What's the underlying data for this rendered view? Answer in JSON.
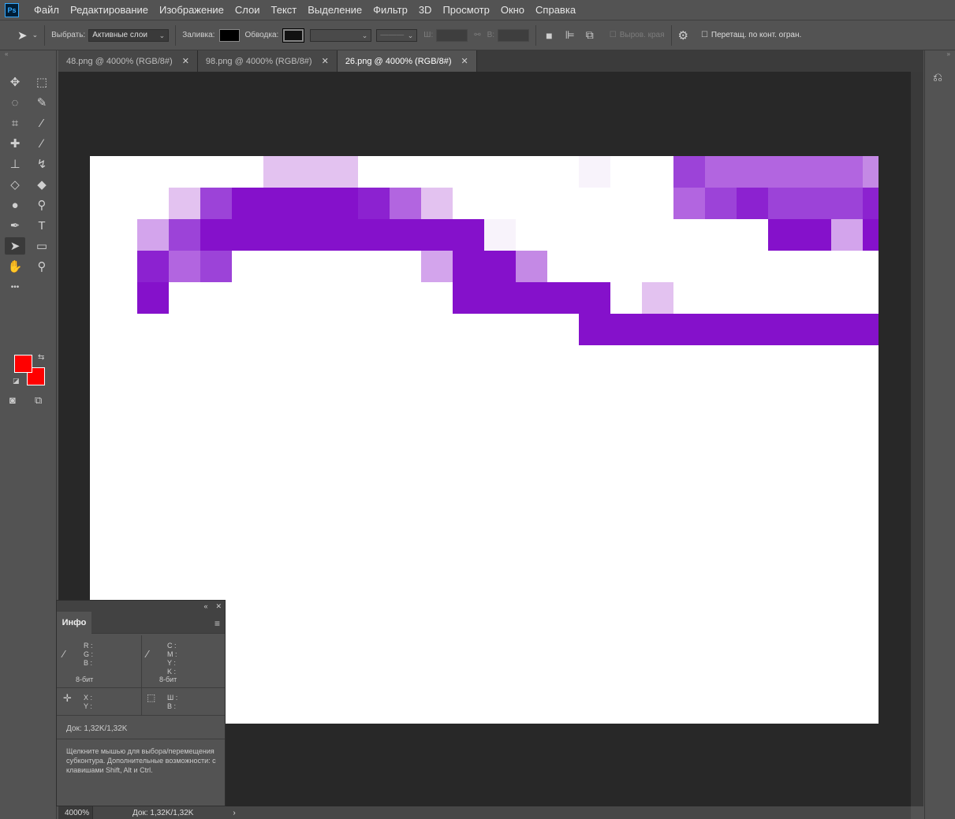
{
  "app": {
    "logo": "Ps"
  },
  "menu": [
    "Файл",
    "Редактирование",
    "Изображение",
    "Слои",
    "Текст",
    "Выделение",
    "Фильтр",
    "3D",
    "Просмотр",
    "Окно",
    "Справка"
  ],
  "options": {
    "select_label": "Выбрать:",
    "select_value": "Активные слои",
    "fill_label": "Заливка:",
    "stroke_label": "Обводка:",
    "w_label": "Ш:",
    "h_label": "В:",
    "align_edges": "Выров. края",
    "constrain": "Перетащ. по конт. огран."
  },
  "tabs": [
    {
      "label": "48.png @ 4000% (RGB/8#)",
      "active": false
    },
    {
      "label": "98.png @ 4000% (RGB/8#)",
      "active": false
    },
    {
      "label": "26.png @ 4000% (RGB/8#)",
      "active": true
    }
  ],
  "tools": [
    {
      "name": "move-tool-icon",
      "glyph": "✥"
    },
    {
      "name": "marquee-tool-icon",
      "glyph": "⬚"
    },
    {
      "name": "lasso-tool-icon",
      "glyph": "◌"
    },
    {
      "name": "quick-select-tool-icon",
      "glyph": "✎"
    },
    {
      "name": "crop-tool-icon",
      "glyph": "⌗"
    },
    {
      "name": "eyedropper-tool-icon",
      "glyph": "⁄"
    },
    {
      "name": "healing-brush-icon",
      "glyph": "✚"
    },
    {
      "name": "brush-tool-icon",
      "glyph": "∕"
    },
    {
      "name": "clone-stamp-icon",
      "glyph": "⊥"
    },
    {
      "name": "history-brush-icon",
      "glyph": "↯"
    },
    {
      "name": "eraser-tool-icon",
      "glyph": "◇"
    },
    {
      "name": "paint-bucket-icon",
      "glyph": "◆"
    },
    {
      "name": "blur-tool-icon",
      "glyph": "●"
    },
    {
      "name": "dodge-tool-icon",
      "glyph": "⚲"
    },
    {
      "name": "pen-tool-icon",
      "glyph": "✒"
    },
    {
      "name": "type-tool-icon",
      "glyph": "T"
    },
    {
      "name": "path-select-tool-icon",
      "glyph": "➤"
    },
    {
      "name": "rectangle-tool-icon",
      "glyph": "▭"
    },
    {
      "name": "hand-tool-icon",
      "glyph": "✋"
    },
    {
      "name": "zoom-tool-icon",
      "glyph": "⚲"
    },
    {
      "name": "more-tools-icon",
      "glyph": "•••"
    }
  ],
  "colors": {
    "foreground": "#ff0000",
    "background": "#ff0000"
  },
  "image": {
    "palette": [
      "#ffffff",
      "#f8f3fb",
      "#f1e3f8",
      "#e3c2f0",
      "#d3a4ec",
      "#c489e5",
      "#b265e0",
      "#9c43d8",
      "#8c22d0",
      "#8511cb"
    ],
    "rows": [
      "0000003330000000100766666566600",
      "0003799998630000000678777885900",
      "0047999999999100000000994999990",
      "0086700000049950000000000000000",
      "0090000000009999903000000009999",
      "0000000000000000999999999999999",
      "0000000000000000000000000000000",
      "0000000000000000000000000000000",
      "0000000000000000000000000000000",
      "0000000000000000000000000000000",
      "0000000000000000000000000000000",
      "0000000000000000000000000000000",
      "0000000000000000000000000000000",
      "0000000000000000000000000000000",
      "0000000000000000000000000000000",
      "0000000000000000000000000000000",
      "0000000000000000000000000000000",
      "0000000000000000000000000000000"
    ]
  },
  "info_panel": {
    "tab": "Инфо",
    "rgb_labels": [
      "R :",
      "G :",
      "B :"
    ],
    "cmyk_labels": [
      "C :",
      "M :",
      "Y :",
      "K :"
    ],
    "bit_left": "8-бит",
    "bit_right": "8-бит",
    "xy_labels": [
      "X :",
      "Y :"
    ],
    "wh_labels": [
      "Ш :",
      "В :"
    ],
    "doc": "Док: 1,32K/1,32K",
    "hint": "Щелкните мышью для выбора/перемещения субконтура. Дополнительные возможности: с клавишами Shift, Alt и Ctrl."
  },
  "status": {
    "zoom": "4000%",
    "doc": "Док: 1,32K/1,32K"
  }
}
